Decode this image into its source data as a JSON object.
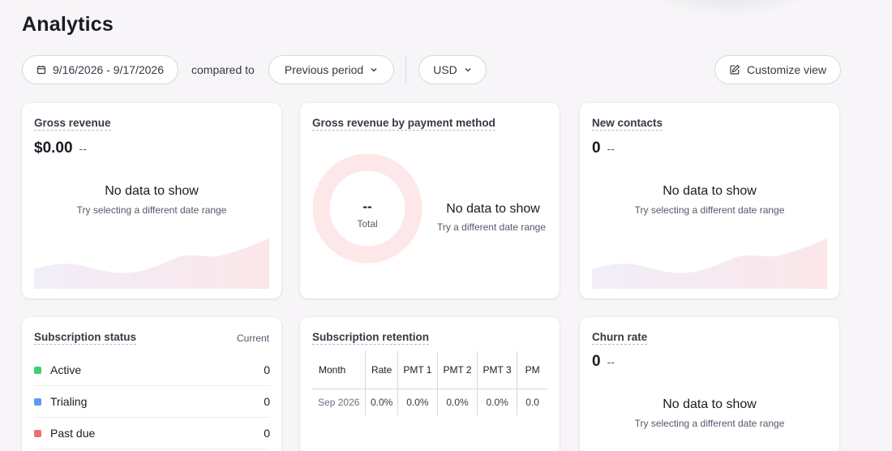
{
  "page": {
    "title": "Analytics"
  },
  "toolbar": {
    "date_range": "9/16/2026 - 9/17/2026",
    "compared_label": "compared to",
    "period": "Previous period",
    "currency": "USD",
    "customize": "Customize view"
  },
  "cards": {
    "gross_revenue": {
      "title": "Gross revenue",
      "value": "$0.00",
      "delta": "--",
      "empty_title": "No data to show",
      "empty_sub": "Try selecting a different date range"
    },
    "payment_method": {
      "title": "Gross revenue by payment method",
      "center_value": "--",
      "center_label": "Total",
      "empty_title": "No data to show",
      "empty_sub": "Try a different date range"
    },
    "new_contacts": {
      "title": "New contacts",
      "value": "0",
      "delta": "--",
      "empty_title": "No data to show",
      "empty_sub": "Try selecting a different date range"
    },
    "subscription_status": {
      "title": "Subscription status",
      "header_right": "Current",
      "items": [
        {
          "label": "Active",
          "count": "0",
          "color": "#3ecf6e"
        },
        {
          "label": "Trialing",
          "count": "0",
          "color": "#5b9cf0"
        },
        {
          "label": "Past due",
          "count": "0",
          "color": "#ee6e73"
        }
      ]
    },
    "subscription_retention": {
      "title": "Subscription retention",
      "headers": [
        "Month",
        "Rate",
        "PMT 1",
        "PMT 2",
        "PMT 3",
        "PM"
      ],
      "rows": [
        [
          "Sep 2026",
          "0.0%",
          "0.0%",
          "0.0%",
          "0.0%",
          "0.0"
        ]
      ]
    },
    "churn_rate": {
      "title": "Churn rate",
      "value": "0",
      "delta": "--",
      "empty_title": "No data to show",
      "empty_sub": "Try selecting a different date range"
    }
  },
  "colors": {
    "accent_soft": "#fde7e8",
    "placeholder_area": "#f6eef6",
    "active": "#3ecf6e",
    "trialing": "#5b9cf0",
    "past_due": "#ee6e73"
  },
  "icons": {
    "date": "calendar-icon",
    "dropdown": "chevron-down-icon",
    "customize": "edit-icon"
  }
}
